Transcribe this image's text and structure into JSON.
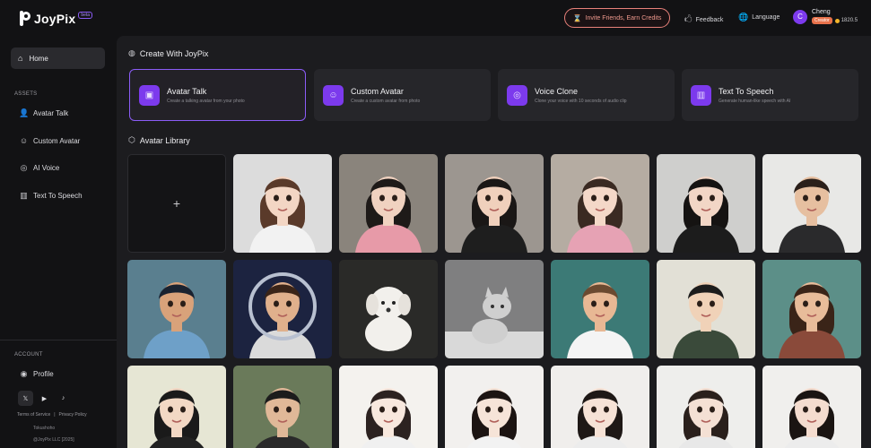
{
  "app": {
    "logo_text": "JoyPix",
    "logo_badge": "beta"
  },
  "header": {
    "invite_label": "Invite Friends, Earn Credits",
    "invite_icon": "hourglass-icon",
    "feedback_label": "Feedback",
    "feedback_icon": "feedback-icon",
    "language_label": "Language",
    "language_icon": "globe-icon",
    "user": {
      "initial": "C",
      "name": "Cheng",
      "badge": "Creator",
      "credits": "1820.5"
    }
  },
  "sidebar": {
    "home_label": "Home",
    "assets_title": "ASSETS",
    "items": [
      {
        "label": "Avatar Talk",
        "icon": "user-icon"
      },
      {
        "label": "Custom Avatar",
        "icon": "smile-icon"
      },
      {
        "label": "AI Voice",
        "icon": "voice-icon"
      },
      {
        "label": "Text To Speech",
        "icon": "text-speech-icon"
      }
    ],
    "account_title": "ACCOUNT",
    "profile_label": "Profile",
    "socials": [
      "x-icon",
      "youtube-icon",
      "tiktok-icon"
    ],
    "footer": {
      "terms": "Terms of Service",
      "separator": "|",
      "privacy": "Privacy Policy",
      "sub": "Tokushoho",
      "copyright": "@JoyPix LLC [2025]"
    }
  },
  "main": {
    "create_title": "Create With JoyPix",
    "cards": [
      {
        "title": "Avatar Talk",
        "subtitle": "Create a talking avatar from your photo",
        "active": true
      },
      {
        "title": "Custom Avatar",
        "subtitle": "Create a custom avatar from photo",
        "active": false
      },
      {
        "title": "Voice Clone",
        "subtitle": "Clone your voice with 10 seconds of audio clip",
        "active": false
      },
      {
        "title": "Text To Speech",
        "subtitle": "Generate human-like speech with AI",
        "active": false
      }
    ],
    "library_title": "Avatar Library",
    "add_symbol": "+"
  },
  "colors": {
    "accent": "#7c3aed",
    "accent_border": "#8b5cf6",
    "invite": "#e8817a",
    "background": "#121214",
    "panel": "#1c1c1f",
    "card": "#26262a"
  }
}
